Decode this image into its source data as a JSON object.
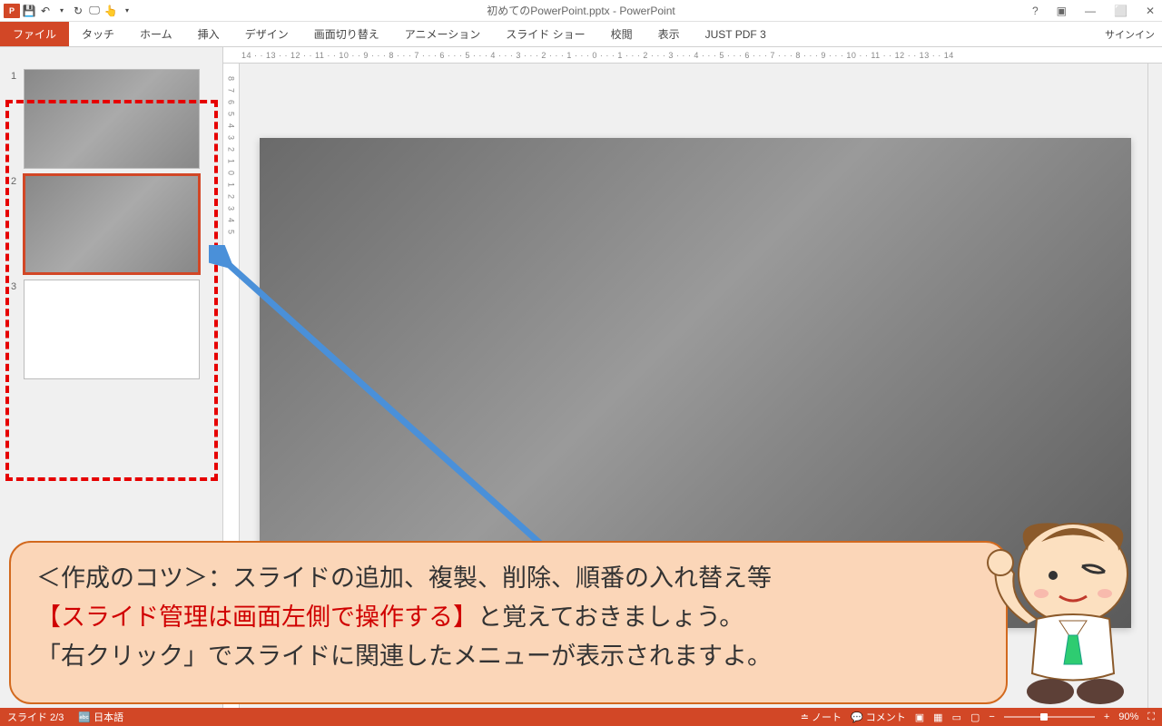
{
  "title": "初めてのPowerPoint.pptx - PowerPoint",
  "tabs": {
    "file": "ファイル",
    "touch": "タッチ",
    "home": "ホーム",
    "insert": "挿入",
    "design": "デザイン",
    "transitions": "画面切り替え",
    "animations": "アニメーション",
    "slideshow": "スライド ショー",
    "review": "校閲",
    "view": "表示",
    "justpdf": "JUST PDF 3"
  },
  "signin": "サインイン",
  "thumbs": {
    "n1": "1",
    "n2": "2",
    "n3": "3"
  },
  "ruler_h": "14 · · 13 · · 12 · · 11 · · 10 · · 9 · · · 8 · · · 7 · · · 6 · · · 5 · · · 4 · · · 3 · · · 2 · · · 1 · · · 0 · · · 1 · · · 2 · · · 3 · · · 4 · · · 5 · · · 6 · · · 7 · · · 8 · · · 9 · · · 10 · · 11 · · 12 · · 13 · · 14",
  "callout": {
    "line1a": "＜作成のコツ＞：スライドの追加、複製、削除、順番の入れ替え等",
    "line2_red": "【スライド管理は画面左側で操作する】",
    "line2b": "と覚えておきましょう。",
    "line3": "「右クリック」でスライドに関連したメニューが表示されますよ。"
  },
  "status": {
    "slide": "スライド 2/3",
    "lang": "日本語",
    "notes": "ノート",
    "comments": "コメント",
    "zoom": "90%"
  }
}
